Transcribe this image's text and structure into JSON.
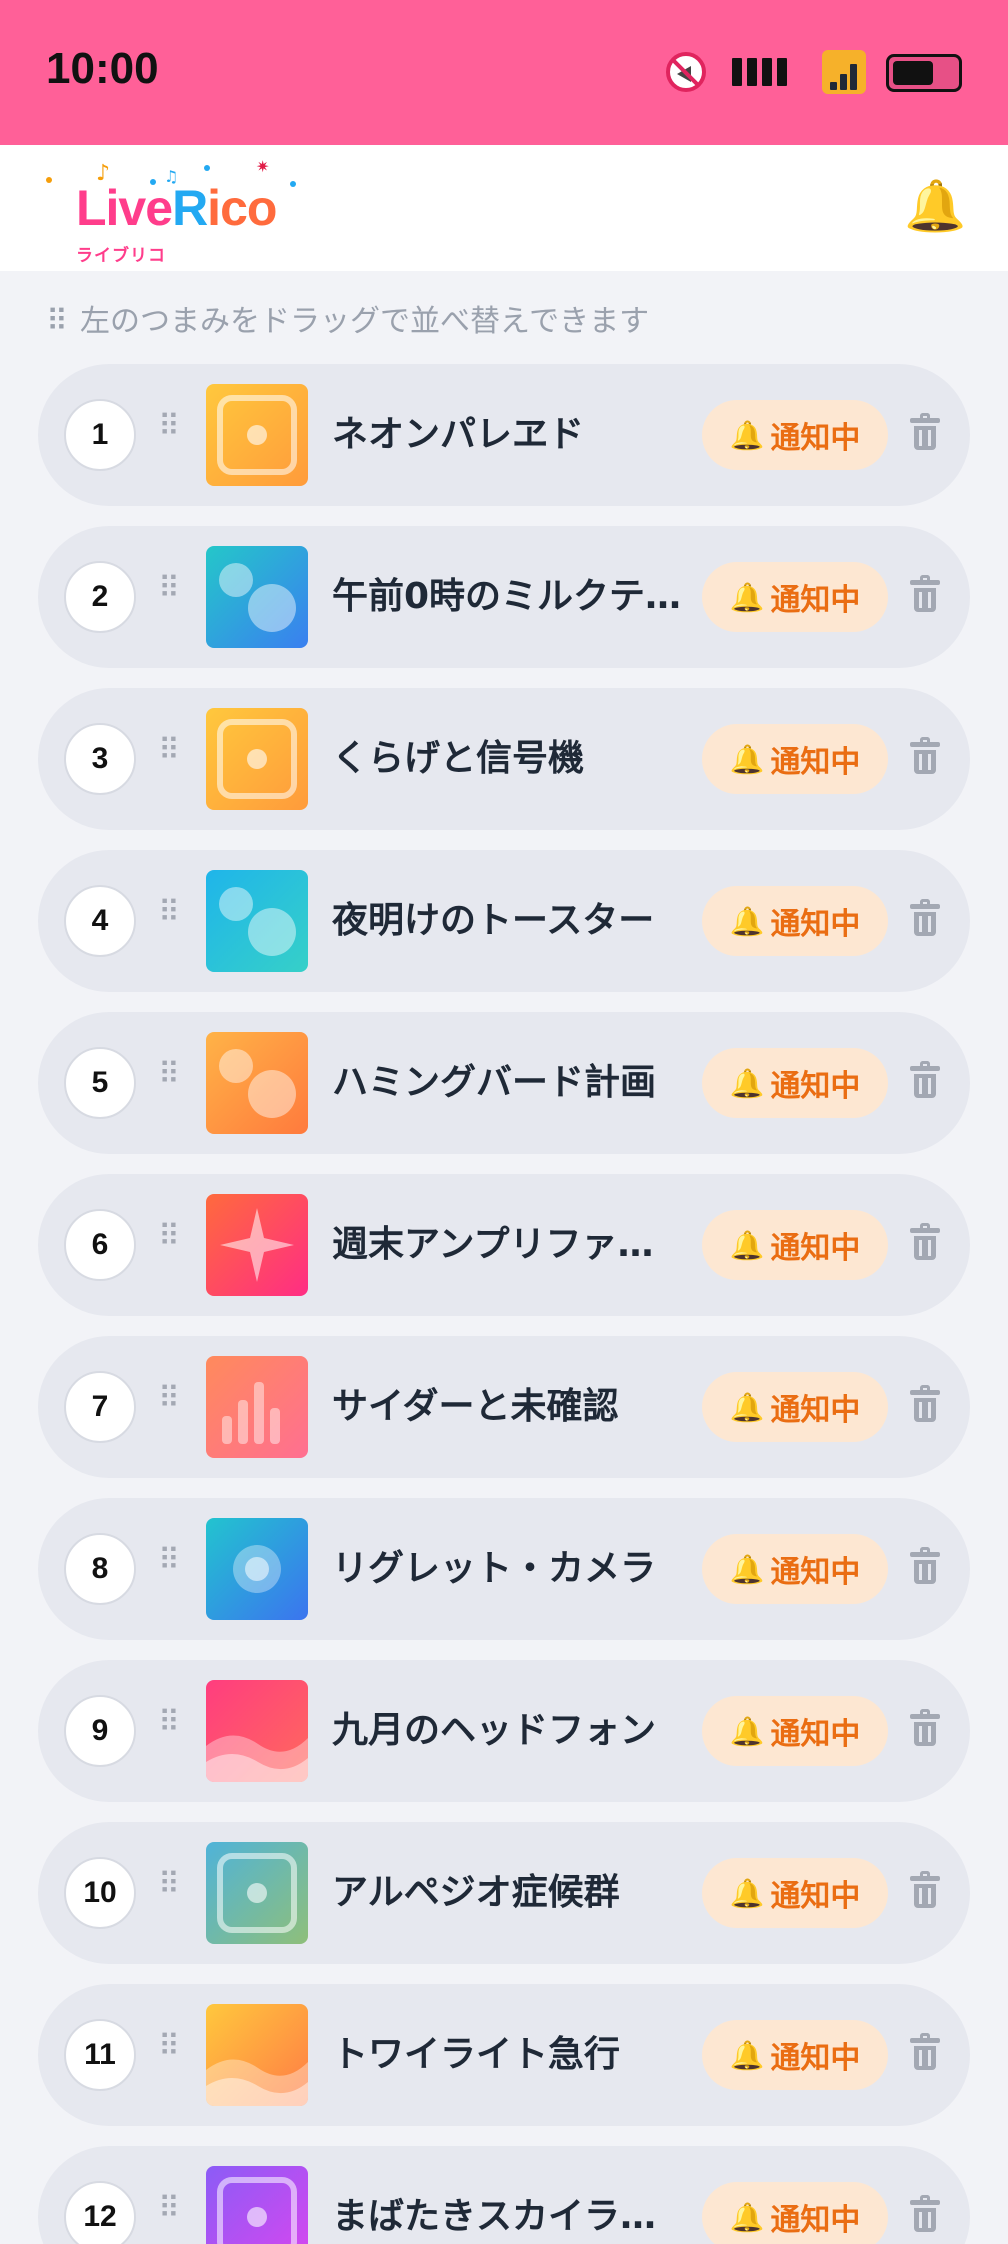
{
  "status_bar": {
    "time": "10:00",
    "icons": [
      "mute-icon",
      "signal-icon",
      "wifi-icon",
      "battery-icon"
    ],
    "background": "#ff6098"
  },
  "header": {
    "logo": {
      "text_main_1": "Live",
      "text_main_2": "R",
      "text_main_3": "i",
      "text_main_4": "co",
      "subtext": "ライブリコ"
    },
    "notifications_icon": "bell-icon"
  },
  "hint": {
    "icon": "drag-handle-icon",
    "text": "左のつまみをドラッグで並べ替えできます"
  },
  "items": [
    {
      "rank": "1",
      "title": "ネオンパレヱド",
      "thumb": "square",
      "badge": "通知中"
    },
    {
      "rank": "2",
      "title": "午前0時のミルクテ…",
      "thumb": "bubbles",
      "badge": "通知中"
    },
    {
      "rank": "3",
      "title": "くらげと信号機",
      "thumb": "square",
      "badge": "通知中"
    },
    {
      "rank": "4",
      "title": "夜明けのトースター",
      "thumb": "bubbles",
      "badge": "通知中"
    },
    {
      "rank": "5",
      "title": "ハミングバード計画",
      "thumb": "bubbles",
      "badge": "通知中"
    },
    {
      "rank": "6",
      "title": "週末アンプリファ…",
      "thumb": "star",
      "badge": "通知中"
    },
    {
      "rank": "7",
      "title": "サイダーと未確認",
      "thumb": "bars",
      "badge": "通知中"
    },
    {
      "rank": "8",
      "title": "リグレット・カメラ",
      "thumb": "circle",
      "badge": "通知中"
    },
    {
      "rank": "9",
      "title": "九月のヘッドフォン",
      "thumb": "waves",
      "badge": "通知中"
    },
    {
      "rank": "10",
      "title": "アルペジオ症候群",
      "thumb": "square",
      "badge": "通知中"
    },
    {
      "rank": "11",
      "title": "トワイライト急行",
      "thumb": "waves",
      "badge": "通知中"
    },
    {
      "rank": "12",
      "title": "まばたきスカイラ…",
      "thumb": "square",
      "badge": "通知中"
    }
  ],
  "colors": {
    "accent": "#ff6098",
    "badge_bg": "#fde7d2",
    "badge_text": "#ea6d12",
    "row_bg": "#e6e8ef",
    "thumb_gradients": [
      [
        "#ffc83d",
        "#ff9b3b"
      ],
      [
        "#24c7c9",
        "#3a7ff0"
      ],
      [
        "#ffc83d",
        "#ff9b3b"
      ],
      [
        "#1fb5ea",
        "#36d0c8"
      ],
      [
        "#ffb347",
        "#ff7a3d"
      ],
      [
        "#ff6a3d",
        "#ff2d84"
      ],
      [
        "#ff8a5c",
        "#ff6f91"
      ],
      [
        "#22c4cf",
        "#3b74ef"
      ],
      [
        "#ff3d7f",
        "#ff6a5c"
      ],
      [
        "#4fb3d9",
        "#8fbf7a"
      ],
      [
        "#ffc83d",
        "#ff7a45"
      ],
      [
        "#8b5cf6",
        "#d946ef"
      ]
    ]
  }
}
